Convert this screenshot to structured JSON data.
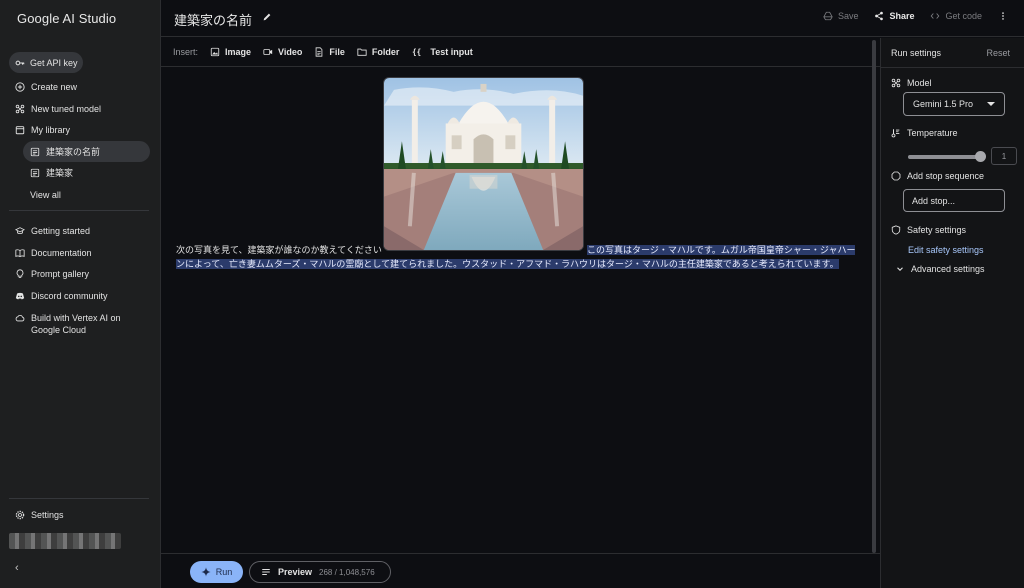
{
  "app": {
    "brand": "Google AI Studio"
  },
  "sidebar": {
    "api_key": "Get API key",
    "items": [
      {
        "label": "Create new"
      },
      {
        "label": "New tuned model"
      },
      {
        "label": "My library"
      }
    ],
    "library": [
      {
        "label": "建築家の名前",
        "active": true
      },
      {
        "label": "建築家"
      }
    ],
    "view_all": "View all",
    "links": [
      {
        "label": "Getting started"
      },
      {
        "label": "Documentation"
      },
      {
        "label": "Prompt gallery"
      },
      {
        "label": "Discord community"
      },
      {
        "label": "Build with Vertex AI on",
        "label2": "Google Cloud"
      }
    ],
    "settings": "Settings",
    "collapse": "‹"
  },
  "header": {
    "title": "建築家の名前",
    "save": "Save",
    "share": "Share",
    "get_code": "Get code"
  },
  "insert": {
    "label": "Insert:",
    "image": "Image",
    "video": "Video",
    "file": "File",
    "folder": "Folder",
    "test_input": "Test input"
  },
  "prompt": {
    "user_text": "次の写真を見て、建築家が誰なのか教えてください",
    "response_line1": "この写真はタージ・マハルです。ムガル帝国皇帝シャー・ジャハー",
    "response_line2": "ンによって、亡き妻ムムターズ・マハルの霊廟として建てられました。ウスタッド・アフマド・ラハウリはタージ・マハルの主任建築家であると考えられています。"
  },
  "run_settings": {
    "title": "Run settings",
    "reset": "Reset",
    "model_label": "Model",
    "model_value": "Gemini 1.5 Pro",
    "temperature_label": "Temperature",
    "temperature_value": "1",
    "stop_label": "Add stop sequence",
    "stop_placeholder": "Add stop...",
    "safety_label": "Safety settings",
    "safety_link": "Edit safety settings",
    "advanced_label": "Advanced settings"
  },
  "footer": {
    "run": "Run",
    "preview": "Preview",
    "token_count": "268 / 1,048,576"
  },
  "colors": {
    "accent": "#8ab4f8",
    "highlight": "#2b3b6b",
    "link": "#a8c7fa"
  }
}
